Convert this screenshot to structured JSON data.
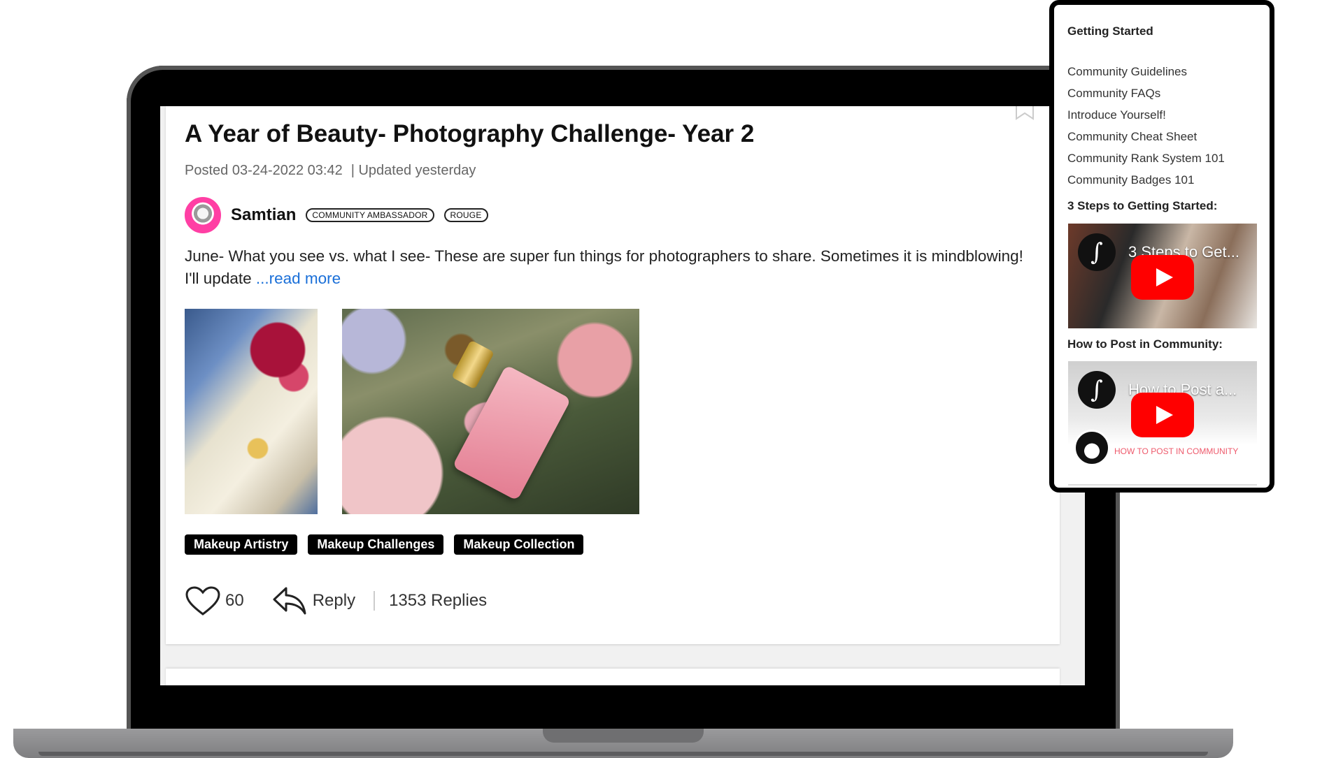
{
  "post": {
    "title": "A Year of Beauty- Photography Challenge- Year 2",
    "posted": "Posted 03-24-2022 03:42",
    "updated": "| Updated yesterday",
    "author": "Samtian",
    "badges": [
      "COMMUNITY AMBASSADOR",
      "ROUGE"
    ],
    "excerpt": "June- What you see vs. what I see- These are super fun things for photographers to share. Sometimes it is mindblowing! I'll update",
    "read_more": "...read more",
    "tags": [
      "Makeup Artistry",
      "Makeup Challenges",
      "Makeup Collection"
    ],
    "likes": "60",
    "reply_label": "Reply",
    "replies": "1353 Replies"
  },
  "sidebar": {
    "heading": "Getting Started",
    "links": [
      "Community Guidelines",
      "Community FAQs",
      "Introduce Yourself!",
      "Community Cheat Sheet",
      "Community Rank System 101",
      "Community Badges 101"
    ],
    "video1_heading": "3 Steps to Getting Started:",
    "video1_title": "3 Steps to Get...",
    "video2_heading": "How to Post in Community:",
    "video2_title": "How to Post a...",
    "video2_caption": "HOW TO POST IN COMMUNITY"
  },
  "colors": {
    "link": "#1a6fd8",
    "tag_bg": "#000000",
    "avatar_ring": "#ff3fa4",
    "play_button": "#ff0000"
  }
}
